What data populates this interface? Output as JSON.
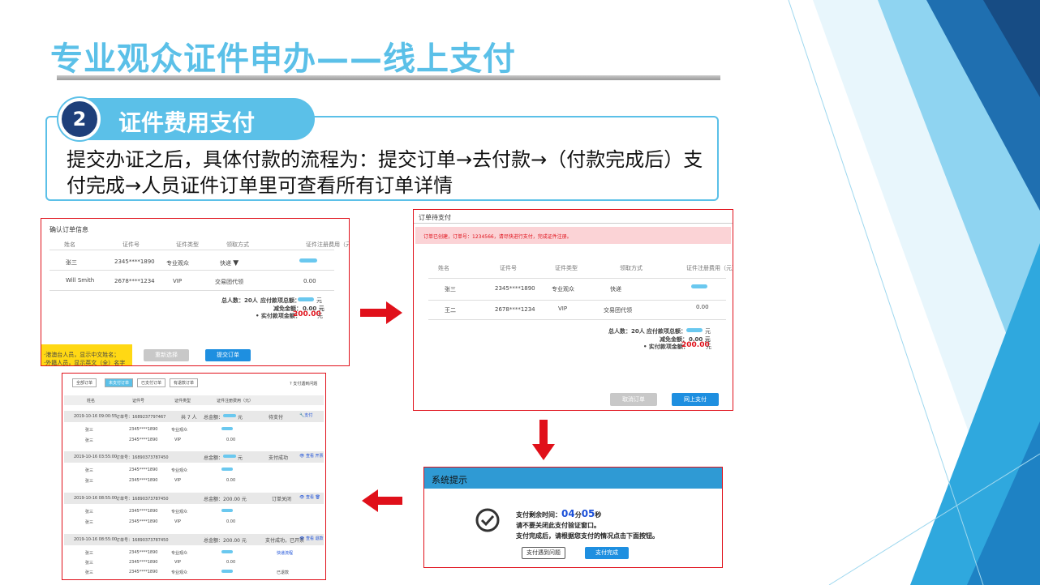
{
  "slide": {
    "title": "专业观众证件申办——线上支付",
    "step_number": "2",
    "step_title": "证件费用支付",
    "description": "提交办证之后，具体付款的流程为：提交订单→去付款→（付款完成后）支付完成→人员证件订单里可查看所有订单详情"
  },
  "confirm_order": {
    "heading": "确认订单信息",
    "columns": [
      "姓名",
      "证件号",
      "证件类型",
      "领取方式",
      "证件注册费用（元）"
    ],
    "rows": [
      {
        "name": "张三",
        "id": "2345****1890",
        "type": "专业观众",
        "method": "快递",
        "fee": ""
      },
      {
        "name": "Will Smith",
        "id": "2678****1234",
        "type": "VIP",
        "method": "交易团代领",
        "fee": "0.00"
      }
    ],
    "total_people": "总人数：20人",
    "payable_label": "应付款项总额：",
    "payable_unit": "元",
    "discount_label": "减免金额：",
    "discount_value": "0.00 元",
    "actual_label": "• 实付款项金额：",
    "actual_value": "200.00",
    "actual_unit": "元",
    "notice_line1": "·港澳台人员，显示中文姓名；",
    "notice_line2": "·外籍人员，显示英文（全）名字",
    "reselect_btn": "重新选择",
    "submit_btn": "提交订单"
  },
  "pending_payment": {
    "heading": "订单待支付",
    "alert": "订单已创建，订单号：1234566，请尽快进行支付，完成证件注册。",
    "columns": [
      "姓名",
      "证件号",
      "证件类型",
      "领取方式",
      "证件注册费用（元）"
    ],
    "rows": [
      {
        "name": "张三",
        "id": "2345****1890",
        "type": "专业观众",
        "method": "快递",
        "fee": ""
      },
      {
        "name": "王二",
        "id": "2678****1234",
        "type": "VIP",
        "method": "交易团代领",
        "fee": "0.00"
      }
    ],
    "total_people": "总人数：20人",
    "payable_label": "应付款项总额：",
    "discount_label": "减免金额：",
    "discount_value": "0.00 元",
    "actual_label": "• 实付款项金额：",
    "actual_value": "200.00",
    "unit": "元",
    "cancel_btn": "取消订单",
    "pay_btn": "网上支付"
  },
  "system_prompt": {
    "heading": "系统提示",
    "countdown_label": "支付剩余时间：",
    "minutes": "04",
    "min_unit": "分",
    "seconds": "05",
    "sec_unit": "秒",
    "line2": "请不要关闭此支付验证窗口。",
    "line3": "支付完成后，请根据您支付的情况点击下面按钮。",
    "problem_btn": "支付遇到问题",
    "done_btn": "支付完成"
  },
  "order_list": {
    "tabs": [
      "全部订单",
      "未支付订单",
      "已支付订单",
      "有退款订单"
    ],
    "help_link": "? 支付遇到问题",
    "columns": [
      "姓名",
      "证件号",
      "证件类型",
      "证件注册费用（元）"
    ],
    "orders": [
      {
        "date": "2019-10-16 09:00:55",
        "order_no": "订单号：1689237797467",
        "extra": "共 7 人",
        "total": "总金额：",
        "amount": "元",
        "status": "待支付",
        "action": "支付",
        "rows": [
          {
            "name": "张三",
            "id": "2345****1890",
            "type": "专业观众",
            "fee": ""
          },
          {
            "name": "张三",
            "id": "2345****1890",
            "type": "VIP",
            "fee": "0.00"
          }
        ]
      },
      {
        "date": "2019-10-16 03:55:00",
        "order_no": "订单号：16890373787450",
        "extra": "",
        "total": "总金额：",
        "amount": "元",
        "status": "支付成功",
        "action": "查看 开票",
        "rows": [
          {
            "name": "张三",
            "id": "2345****1890",
            "type": "专业观众",
            "fee": ""
          },
          {
            "name": "张三",
            "id": "2345****1890",
            "type": "VIP",
            "fee": "0.00"
          }
        ]
      },
      {
        "date": "2019-10-16 08:55:00",
        "order_no": "订单号：16890373787450",
        "extra": "",
        "total": "总金额：",
        "amount": "200.00 元",
        "status": "订单关闭",
        "action": "查看",
        "rows": [
          {
            "name": "张三",
            "id": "2345****1890",
            "type": "专业观众",
            "fee": ""
          },
          {
            "name": "张三",
            "id": "2345****1890",
            "type": "VIP",
            "fee": "0.00"
          }
        ]
      },
      {
        "date": "2019-10-16 08:55:00",
        "order_no": "订单号：16890373787450",
        "extra": "",
        "total": "总金额：",
        "amount": "200.00 元",
        "status": "支付成功，已开票",
        "action": "查看 退款",
        "rows": [
          {
            "name": "张三",
            "id": "2345****1890",
            "type": "专业观众",
            "fee": "",
            "note": "快递流程"
          },
          {
            "name": "张三",
            "id": "2345****1890",
            "type": "VIP",
            "fee": "0.00",
            "note": ""
          },
          {
            "name": "张三",
            "id": "2345****1890",
            "type": "专业观众",
            "fee": "",
            "note": "已退款"
          }
        ]
      }
    ]
  },
  "colors": {
    "accent": "#5bc0e8",
    "frame": "#e0101a",
    "button": "#1e8fe0",
    "dark": "#1e3f7a"
  }
}
